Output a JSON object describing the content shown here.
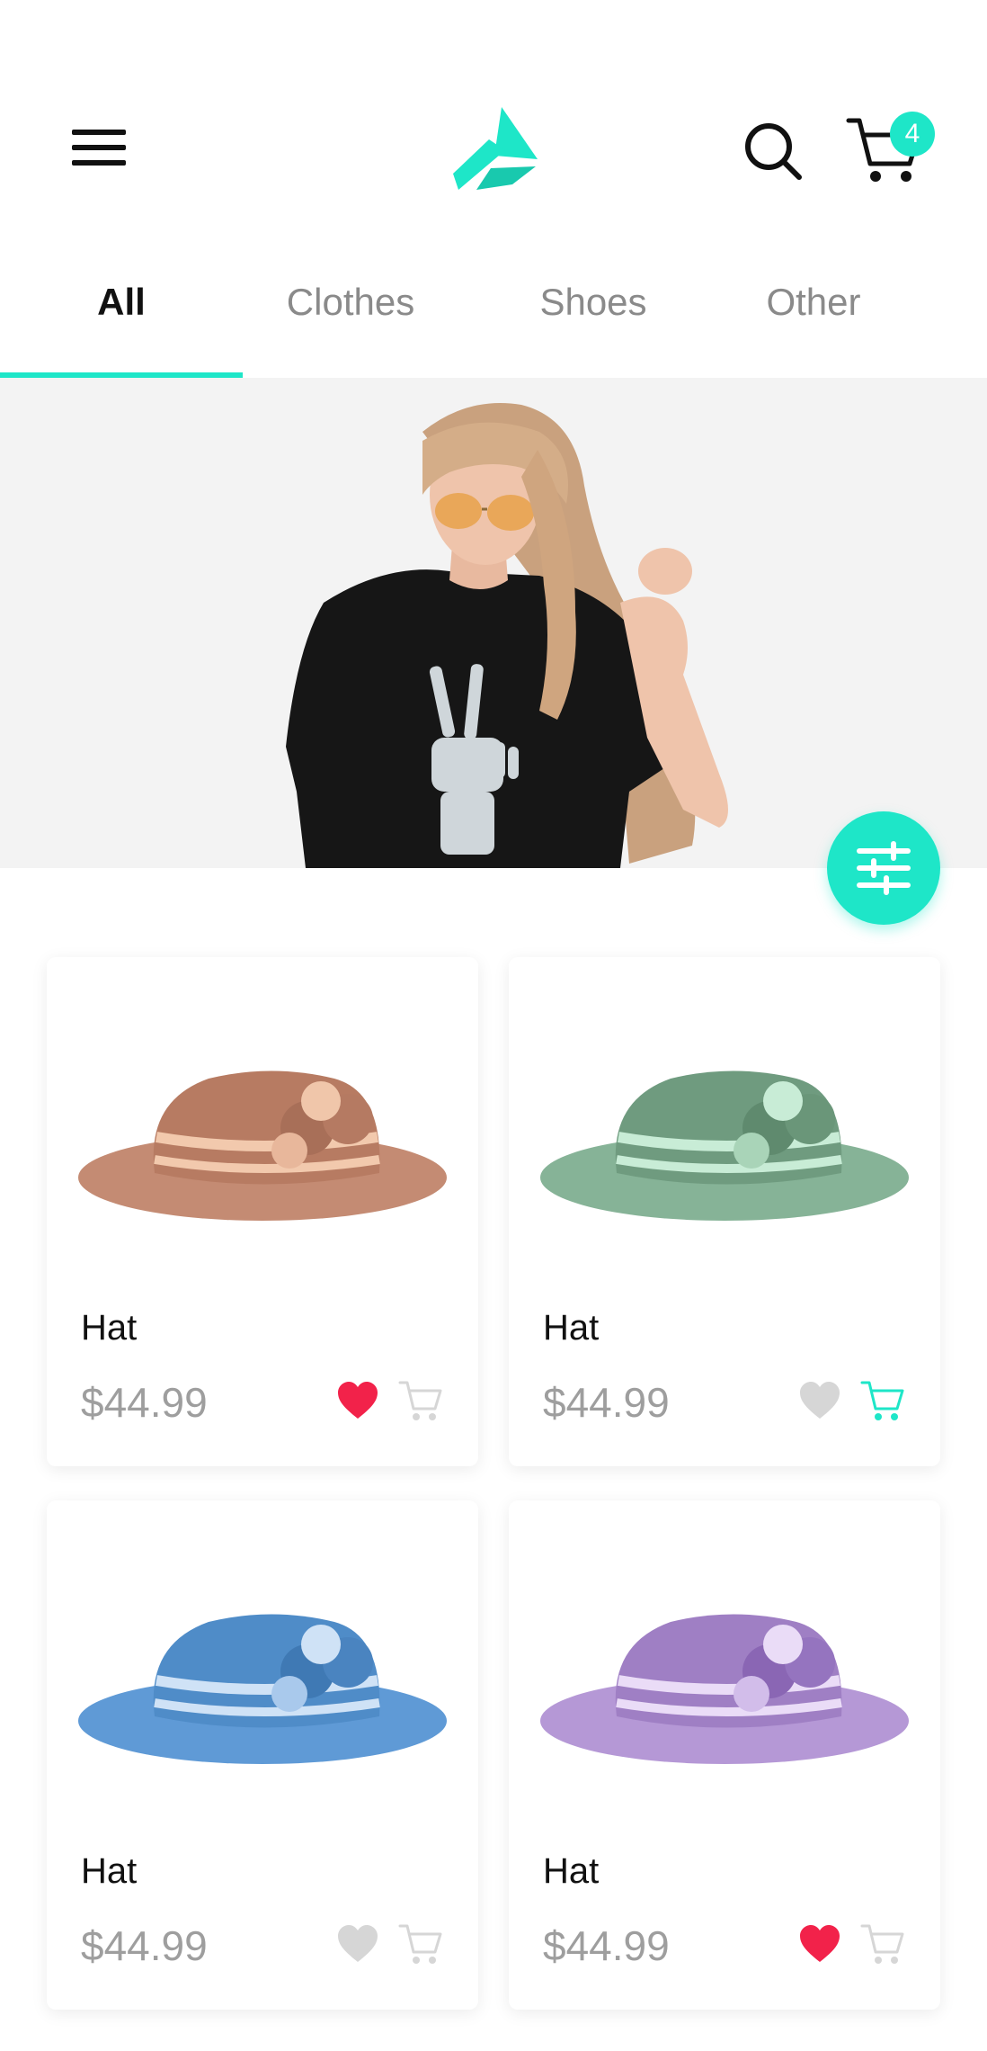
{
  "header": {
    "cart_count": "4"
  },
  "tabs": [
    {
      "label": "All",
      "active": true
    },
    {
      "label": "Clothes",
      "active": false
    },
    {
      "label": "Shoes",
      "active": false
    },
    {
      "label": "Other",
      "active": false
    }
  ],
  "colors": {
    "accent": "#1ee6c8",
    "like_active": "#f2224a",
    "icon_inactive": "#d6d6d6"
  },
  "products": [
    {
      "name": "Hat",
      "price": "$44.99",
      "liked": true,
      "in_cart": false,
      "color": "#c48b73"
    },
    {
      "name": "Hat",
      "price": "$44.99",
      "liked": false,
      "in_cart": true,
      "color": "#6f9b7f"
    },
    {
      "name": "Hat",
      "price": "$44.99",
      "liked": false,
      "in_cart": false,
      "color": "#4f8cc8"
    },
    {
      "name": "Hat",
      "price": "$44.99",
      "liked": true,
      "in_cart": false,
      "color": "#9f7fc4"
    }
  ]
}
